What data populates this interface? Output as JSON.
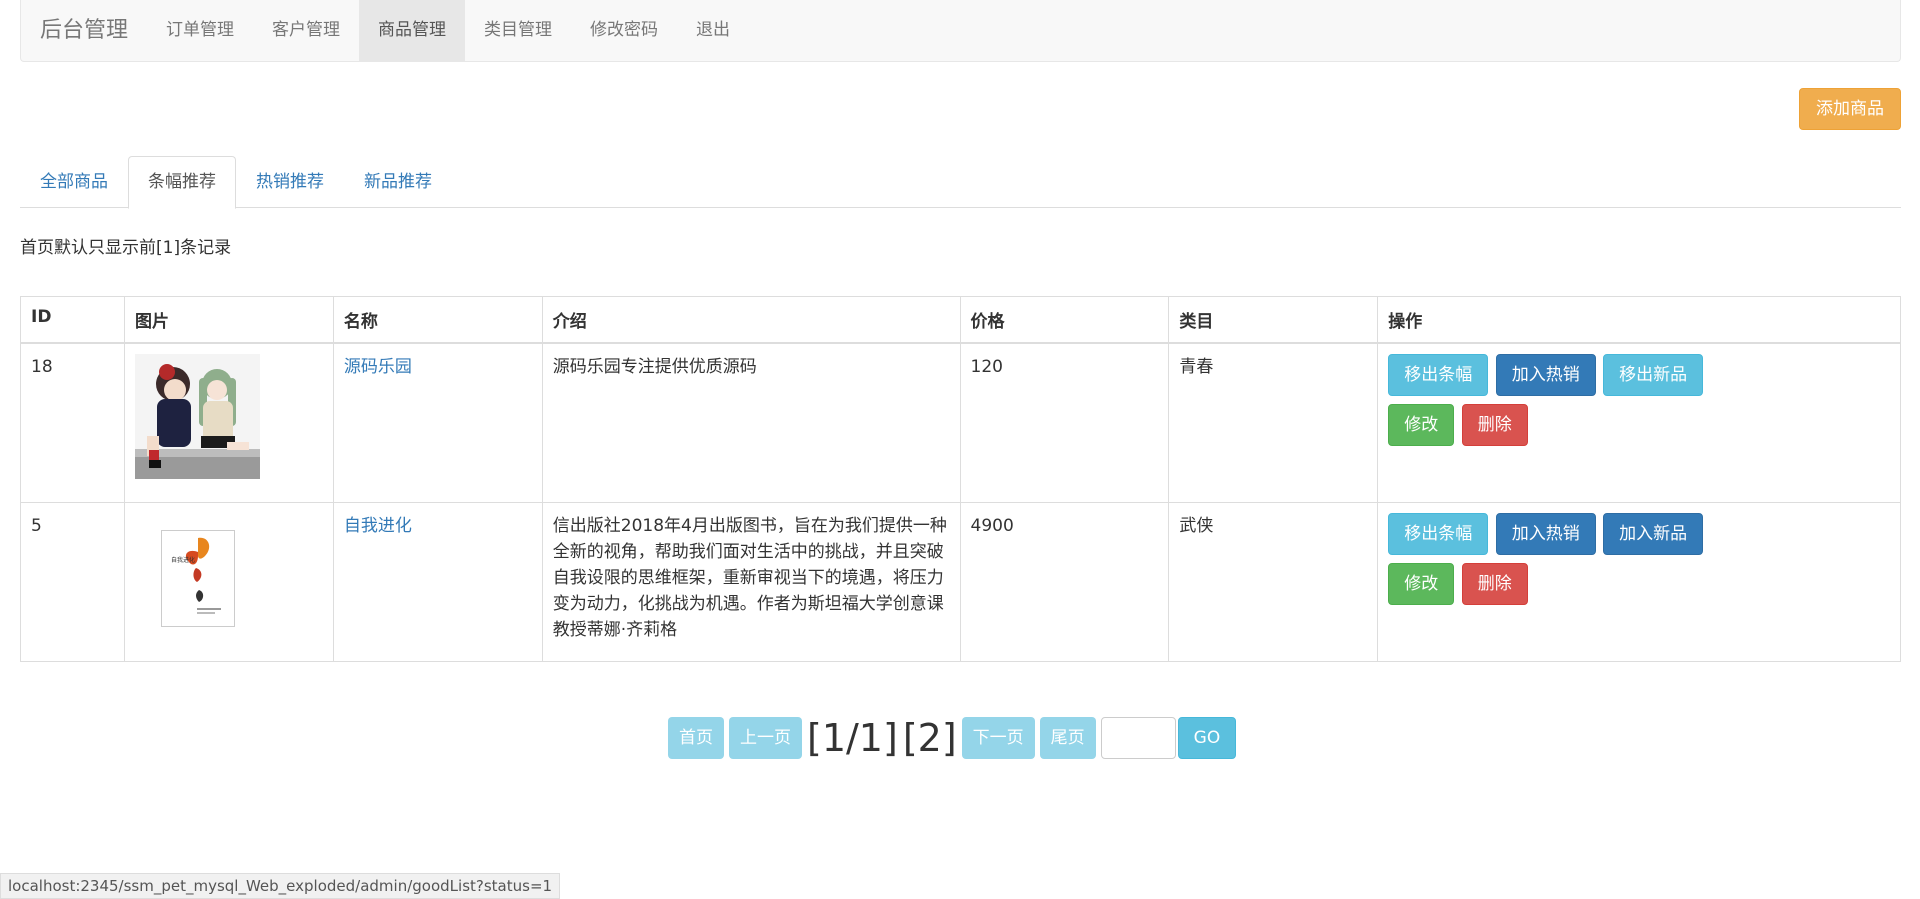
{
  "nav": {
    "brand": "后台管理",
    "items": [
      {
        "label": "订单管理"
      },
      {
        "label": "客户管理"
      },
      {
        "label": "商品管理"
      },
      {
        "label": "类目管理"
      },
      {
        "label": "修改密码"
      },
      {
        "label": "退出"
      }
    ]
  },
  "add_button": "添加商品",
  "tabs": [
    {
      "label": "全部商品"
    },
    {
      "label": "条幅推荐"
    },
    {
      "label": "热销推荐"
    },
    {
      "label": "新品推荐"
    }
  ],
  "notice": "首页默认只显示前[1]条记录",
  "table": {
    "headers": [
      "ID",
      "图片",
      "名称",
      "介绍",
      "价格",
      "类目",
      "操作"
    ],
    "rows": [
      {
        "id": "18",
        "name": "源码乐园",
        "intro": "源码乐园专注提供优质源码",
        "price": "120",
        "category": "青春",
        "actions": [
          "移出条幅",
          "加入热销",
          "移出新品",
          "修改",
          "删除"
        ]
      },
      {
        "id": "5",
        "name": "自我进化",
        "intro": "信出版社2018年4月出版图书，旨在为我们提供一种全新的视角，帮助我们面对生活中的挑战，并且突破自我设限的思维框架，重新审视当下的境遇，将压力变为动力，化挑战为机遇。作者为斯坦福大学创意课教授蒂娜·齐莉格",
        "price": "4900",
        "category": "武侠",
        "book_cover_text": "自我进化",
        "actions": [
          "移出条幅",
          "加入热销",
          "加入新品",
          "修改",
          "删除"
        ]
      }
    ]
  },
  "pager": {
    "first": "首页",
    "prev": "上一页",
    "page_info": "[1/1]",
    "page_link": "[2]",
    "next": "下一页",
    "last": "尾页",
    "go": "GO",
    "input_value": ""
  },
  "status_url": "localhost:2345/ssm_pet_mysql_Web_exploded/admin/goodList?status=1",
  "colors": {
    "warning": "#f0ad4e",
    "info": "#5bc0de",
    "primary": "#337ab7",
    "success": "#5cb85c",
    "danger": "#d9534f",
    "link": "#337ab7"
  }
}
